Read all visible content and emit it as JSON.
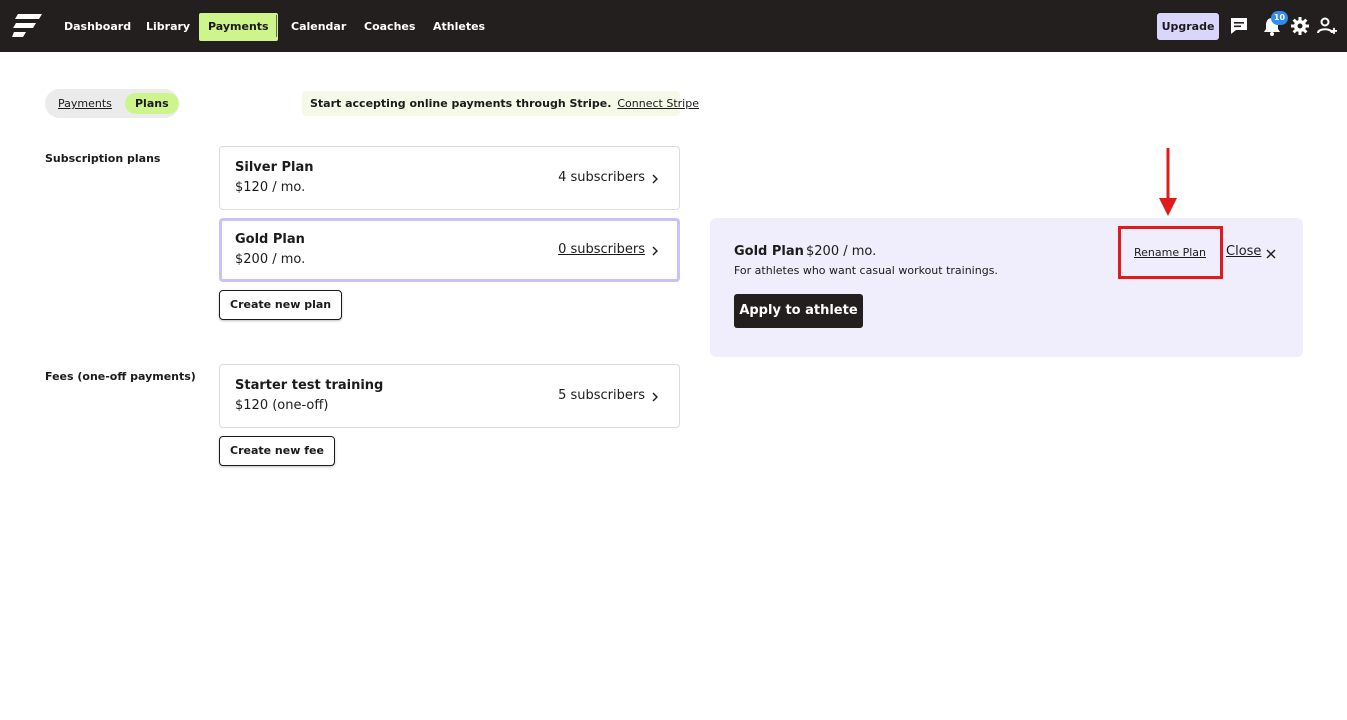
{
  "nav": {
    "items": [
      {
        "label": "Dashboard",
        "active": false
      },
      {
        "label": "Library",
        "active": false
      },
      {
        "label": "Payments",
        "active": true
      },
      {
        "label": "Calendar",
        "active": false
      },
      {
        "label": "Coaches",
        "active": false
      },
      {
        "label": "Athletes",
        "active": false
      }
    ],
    "upgrade_label": "Upgrade",
    "notification_count": "10",
    "icons": [
      "chat-icon",
      "bell-icon",
      "gear-icon",
      "user-add-icon"
    ]
  },
  "tabs": {
    "payments_label": "Payments",
    "plans_label": "Plans",
    "active": "Plans"
  },
  "stripe": {
    "message": "Start accepting online payments through Stripe.",
    "link_label": "Connect Stripe"
  },
  "subscription": {
    "section_label": "Subscription plans",
    "plans": [
      {
        "name": "Silver Plan",
        "price": "$120 / mo.",
        "subscribers": "4 subscribers"
      },
      {
        "name": "Gold Plan",
        "price": "$200 / mo.",
        "subscribers": "0 subscribers",
        "selected": true
      }
    ],
    "create_label": "Create new plan"
  },
  "fees": {
    "section_label": "Fees (one-off payments)",
    "items": [
      {
        "name": "Starter test training",
        "price": "$120 (one-off)",
        "subscribers": "5 subscribers"
      }
    ],
    "create_label": "Create new fee"
  },
  "detail": {
    "title": "Gold Plan",
    "price": "$200 / mo.",
    "description": "For athletes who want casual workout trainings.",
    "apply_label": "Apply to athlete",
    "rename_label": "Rename Plan",
    "close_label": "Close"
  },
  "colors": {
    "topbar": "#231f1f",
    "accent_green": "#cdf58c",
    "accent_lavender": "#dad5fb",
    "panel_bg": "#f0eefc",
    "highlight_red": "#e11b1b",
    "badge_blue": "#2f8cf0"
  }
}
